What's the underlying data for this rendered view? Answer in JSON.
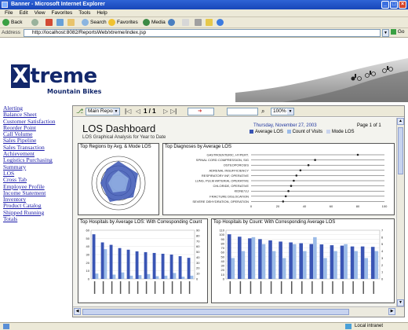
{
  "window": {
    "title": "Banner - Microsoft Internet Explorer"
  },
  "menu": [
    "File",
    "Edit",
    "View",
    "Favorites",
    "Tools",
    "Help"
  ],
  "toolbar": {
    "back": "Back",
    "search": "Search",
    "favorites": "Favorites",
    "media": "Media"
  },
  "address": {
    "label": "Address",
    "url": "http://localhost:8082/ReportsWeb/xtreme/index.jsp",
    "go": "Go"
  },
  "logo": {
    "brand": "treme",
    "brand_initial": "X",
    "tagline": "Mountain Bikes"
  },
  "sidebar": [
    "Alerting",
    "Balance Sheet",
    "Customer Satisfaction",
    "Reorder Point",
    "Call Volume",
    "Sales Pipeline",
    "Sales Transaction",
    "Achievement",
    "Logistics Purchasing",
    "Summary",
    "LOS",
    "Cross Tab",
    "Employee Profile",
    "Income Statement",
    "Inventory",
    "Product Catalog",
    "Shipped Running",
    "Totals"
  ],
  "report_toolbar": {
    "report_select": "Main Report",
    "page_nav": "1 / 1",
    "zoom": "100%"
  },
  "report": {
    "title": "LOS Dashboard",
    "subtitle": "LOS Graphical Analysis for Year to Date",
    "date": "Thursday, November 27, 2003",
    "page": "Page 1 of 1",
    "legend": [
      "Average LOS",
      "Count of Visits",
      "Mode LOS"
    ]
  },
  "colors": {
    "avg": "#3a55b4",
    "count": "#9bbbe8",
    "mode": "#c9d4ee",
    "link": "#1a1aa8"
  },
  "panels": {
    "regions": {
      "title": "Top Regions by Avg. & Mode LOS"
    },
    "diagnoses": {
      "title": "Top Diagnoses by Average LOS"
    },
    "hosp_avg": {
      "title": "Top Hospitals by Average LOS: With Corresponding Count"
    },
    "hosp_count": {
      "title": "Top Hospitals by Count: With Corresponding Average LOS"
    }
  },
  "chart_data": [
    {
      "type": "scatter",
      "title": "Top Diagnoses by Average LOS",
      "categories": [
        "GASTROENTERIC, HYPERT.",
        "SPINAL CORD COMPRESSION, SIG",
        "OSTEOPOROSIS",
        "ADRENAL INSUFFICIENCY",
        "RESPIRATORY INF, OPERATIVE",
        "LUNG, PULM ARTERIAL OPERATIVE",
        "CHLORIDE, OPERATIVE",
        "KIDNEY,U",
        "FRACTURE DISLOCATION",
        "SEVERE DEHYDRATION, OPERATION"
      ],
      "values": [
        80,
        48,
        43,
        37,
        34,
        32,
        30,
        28,
        26,
        24
      ],
      "x_ticks": [
        "0",
        "20",
        "40",
        "60",
        "80",
        "100"
      ],
      "xlim": [
        0,
        100
      ]
    },
    {
      "type": "bar",
      "title": "Top Hospitals by Average LOS: With Corresponding Count",
      "series": [
        {
          "name": "Average LOS",
          "values": [
            55,
            45,
            42,
            38,
            36,
            34,
            33,
            32,
            31,
            30,
            28,
            26
          ]
        },
        {
          "name": "Count of Visits",
          "values": [
            10,
            55,
            8,
            12,
            6,
            7,
            9,
            5,
            6,
            11,
            4,
            6
          ]
        }
      ],
      "y_ticks": [
        "0",
        "10",
        "20",
        "30",
        "40",
        "50",
        "60"
      ],
      "y2_ticks": [
        "0",
        "10",
        "20",
        "30",
        "40",
        "50",
        "60",
        "70",
        "80",
        "90"
      ],
      "ylim": [
        0,
        60
      ]
    },
    {
      "type": "bar",
      "title": "Top Hospitals by Count: With Corresponding Average LOS",
      "series": [
        {
          "name": "Count of Visits",
          "values": [
            110,
            104,
            100,
            98,
            95,
            92,
            90,
            88,
            86,
            85,
            83,
            82,
            80,
            80,
            79
          ]
        },
        {
          "name": "Average LOS",
          "values": [
            3,
            4,
            6,
            5,
            4,
            3,
            5,
            4,
            6,
            3,
            4,
            5,
            4,
            3,
            4
          ]
        }
      ],
      "y_ticks": [
        "0",
        "10",
        "20",
        "30",
        "40",
        "50",
        "60",
        "70",
        "80",
        "90",
        "100",
        "110"
      ],
      "y2_ticks": [
        "0",
        "1",
        "2",
        "3",
        "4",
        "5",
        "6",
        "7"
      ],
      "ylim": [
        0,
        120
      ]
    }
  ],
  "status": {
    "right": "Local intranet"
  }
}
